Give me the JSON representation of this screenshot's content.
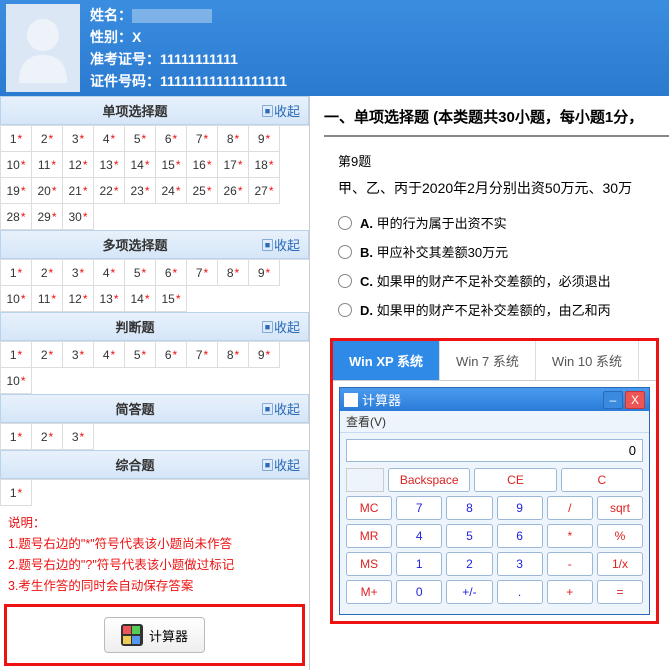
{
  "header": {
    "name_label": "姓名：",
    "gender_label": "性别：",
    "gender_value": "X",
    "exam_id_label": "准考证号：",
    "exam_id_value": "11111111111",
    "cert_label": "证件号码：",
    "cert_value": "111111111111111111"
  },
  "collapse_label": "收起",
  "sections": [
    {
      "title": "单项选择题",
      "count": 30
    },
    {
      "title": "多项选择题",
      "count": 15
    },
    {
      "title": "判断题",
      "count": 10
    },
    {
      "title": "简答题",
      "count": 3
    },
    {
      "title": "综合题",
      "count": 1
    }
  ],
  "notes": {
    "title": "说明：",
    "l1": "1.题号右边的\"*\"符号代表该小题尚未作答",
    "l2": "2.题号右边的\"?\"符号代表该小题做过标记",
    "l3": "3.考生作答的同时会自动保存答案"
  },
  "calc_btn_label": "计算器",
  "question": {
    "heading": "一、单项选择题 (本类题共30小题，每小题1分，",
    "num": "第9题",
    "text": "甲、乙、丙于2020年2月分别出资50万元、30万",
    "opts": [
      {
        "k": "A.",
        "t": "甲的行为属于出资不实"
      },
      {
        "k": "B.",
        "t": "甲应补交其差额30万元"
      },
      {
        "k": "C.",
        "t": "如果甲的财产不足补交差额的，必须退出"
      },
      {
        "k": "D.",
        "t": "如果甲的财产不足补交差额的，由乙和丙"
      }
    ]
  },
  "tabs": [
    "Win XP 系统",
    "Win 7 系统",
    "Win 10 系统"
  ],
  "calc": {
    "title": "计算器",
    "menu": "查看(V)",
    "display": "0",
    "row0": [
      "Backspace",
      "CE",
      "C"
    ],
    "rows": [
      [
        "MC",
        "7",
        "8",
        "9",
        "/",
        "sqrt"
      ],
      [
        "MR",
        "4",
        "5",
        "6",
        "*",
        "%"
      ],
      [
        "MS",
        "1",
        "2",
        "3",
        "-",
        "1/x"
      ],
      [
        "M+",
        "0",
        "+/-",
        ".",
        "+",
        "="
      ]
    ]
  }
}
